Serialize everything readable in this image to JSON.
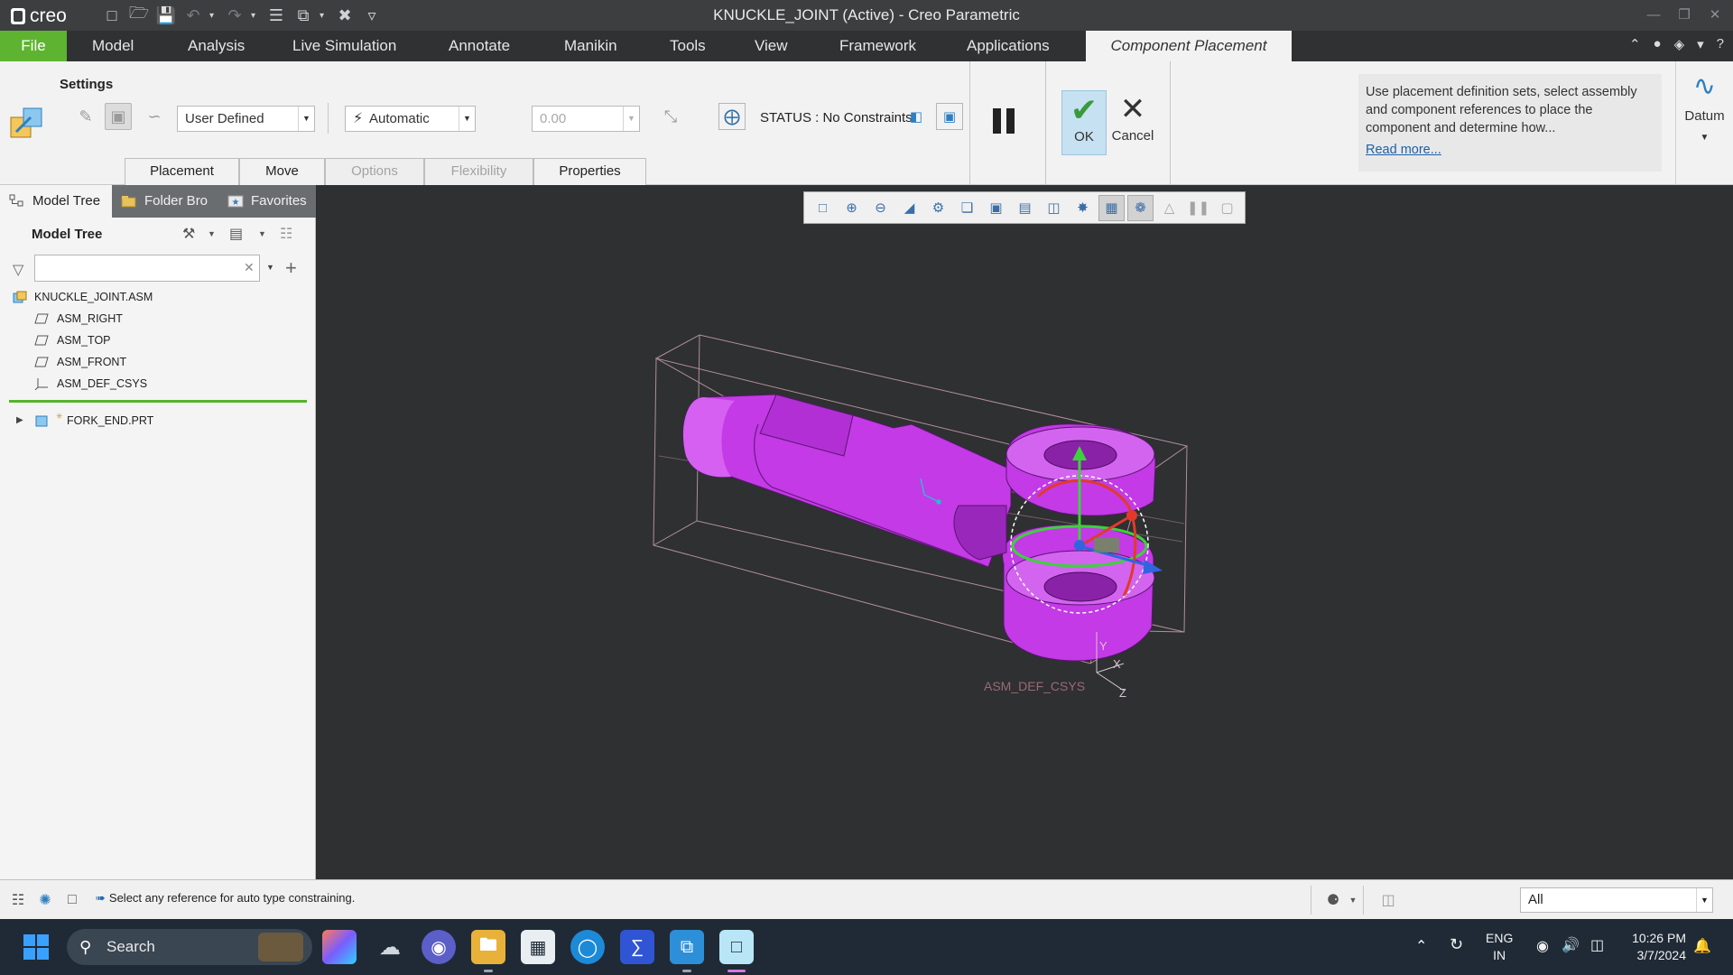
{
  "window": {
    "title": "KNUCKLE_JOINT (Active) - Creo Parametric",
    "logo": "creo"
  },
  "ribbon_tabs": [
    "File",
    "Model",
    "Analysis",
    "Live Simulation",
    "Annotate",
    "Manikin",
    "Tools",
    "View",
    "Framework",
    "Applications",
    "Component Placement"
  ],
  "active_tab": "Component Placement",
  "ribbon": {
    "settings_label": "Settings",
    "constraint_set": "User Defined",
    "constraint_type": "Automatic",
    "offset_value": "0.00",
    "status": "STATUS : No Constraints",
    "ok_label": "OK",
    "cancel_label": "Cancel",
    "help_text": "Use placement definition sets, select assembly and component references to place the component and determine how...",
    "help_link": "Read more...",
    "datum_label": "Datum",
    "subtabs": [
      "Placement",
      "Move",
      "Options",
      "Flexibility",
      "Properties"
    ]
  },
  "navigator": {
    "tabs": [
      "Model Tree",
      "Folder Bro",
      "Favorites"
    ],
    "header": "Model Tree",
    "filter_placeholder": "",
    "tree": [
      {
        "label": "KNUCKLE_JOINT.ASM",
        "icon": "assembly-icon"
      },
      {
        "label": "ASM_RIGHT",
        "icon": "datum-plane-icon"
      },
      {
        "label": "ASM_TOP",
        "icon": "datum-plane-icon"
      },
      {
        "label": "ASM_FRONT",
        "icon": "datum-plane-icon"
      },
      {
        "label": "ASM_DEF_CSYS",
        "icon": "csys-icon"
      },
      {
        "label": "FORK_END.PRT",
        "icon": "part-icon"
      }
    ]
  },
  "viewport": {
    "csys_label": "ASM_DEF_CSYS",
    "axis_labels": [
      "X",
      "Y",
      "Z"
    ],
    "model_color": "#c030e0",
    "background": "#2e3032"
  },
  "statusbar": {
    "message": "Select any reference for auto type constraining.",
    "filter_value": "All"
  },
  "taskbar": {
    "search_label": "Search",
    "lang_line1": "ENG",
    "lang_line2": "IN",
    "time": "10:26 PM",
    "date": "3/7/2024"
  },
  "colors": {
    "file_tab": "#5eb430",
    "accent_blue": "#2e7fc2",
    "ok_bg": "#c6e1f1"
  }
}
